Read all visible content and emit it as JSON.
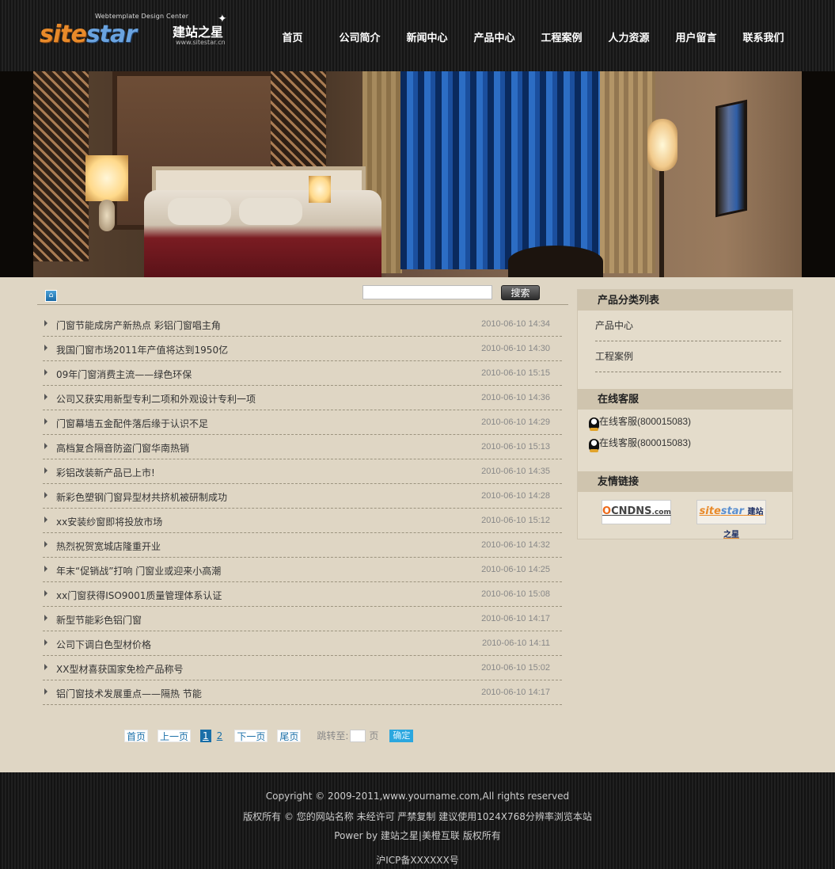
{
  "logo": {
    "sub": "Webtemplate Design Center",
    "brand_a": "site",
    "brand_b": "star",
    "brand_cn": "建站之星",
    "url": "www.sitestar.cn"
  },
  "nav": [
    "首页",
    "公司简介",
    "新闻中心",
    "产品中心",
    "工程案例",
    "人力资源",
    "用户留言",
    "联系我们"
  ],
  "search": {
    "placeholder": "",
    "button": "搜索"
  },
  "news": [
    {
      "title": "门窗节能成房产新热点 彩铝门窗唱主角",
      "date": "2010-06-10 14:34"
    },
    {
      "title": "我国门窗市场2011年产值将达到1950亿",
      "date": "2010-06-10 14:30"
    },
    {
      "title": "09年门窗消费主流——绿色环保",
      "date": "2010-06-10 15:15"
    },
    {
      "title": "公司又获实用新型专利二项和外观设计专利一项",
      "date": "2010-06-10 14:36"
    },
    {
      "title": "门窗幕墙五金配件落后缘于认识不足",
      "date": "2010-06-10 14:29"
    },
    {
      "title": "高档复合隔音防盗门窗华南热销",
      "date": "2010-06-10 15:13"
    },
    {
      "title": "彩铝改装新产品已上市!",
      "date": "2010-06-10 14:35"
    },
    {
      "title": "新彩色塑钢门窗异型材共挤机被研制成功",
      "date": "2010-06-10 14:28"
    },
    {
      "title": "xx安装纱窗即将投放市场",
      "date": "2010-06-10 15:12"
    },
    {
      "title": "热烈祝贺宽城店隆重开业",
      "date": "2010-06-10 14:32"
    },
    {
      "title": "年末“促销战”打响 门窗业或迎来小高潮",
      "date": "2010-06-10 14:25"
    },
    {
      "title": "xx门窗获得ISO9001质量管理体系认证",
      "date": "2010-06-10 15:08"
    },
    {
      "title": "新型节能彩色铝门窗",
      "date": "2010-06-10 14:17"
    },
    {
      "title": "公司下调白色型材价格",
      "date": "2010-06-10 14:11"
    },
    {
      "title": "XX型材喜获国家免检产品称号",
      "date": "2010-06-10 15:02"
    },
    {
      "title": "铝门窗技术发展重点——隔热 节能",
      "date": "2010-06-10 14:17"
    }
  ],
  "pager": {
    "first": "首页",
    "prev": "上一页",
    "pages": [
      "1",
      "2"
    ],
    "current": "1",
    "next": "下一页",
    "last": "尾页",
    "jump_label": "跳转至:",
    "page_unit": "页",
    "go": "确定"
  },
  "sidebar": {
    "categories_title": "产品分类列表",
    "categories": [
      "产品中心",
      "工程案例"
    ],
    "service_title": "在线客服",
    "services": [
      "在线客服(800015083)",
      "在线客服(800015083)"
    ],
    "links_title": "友情链接",
    "link_logos": [
      "CNDNS",
      "sitestar 建站之星"
    ]
  },
  "footer": {
    "copyright": "Copyright © 2009-2011,www.yourname.com,All rights reserved",
    "rights": "版权所有 © 您的网站名称 未经许可 严禁复制 建议使用1024X768分辨率浏览本站",
    "power": "Power by 建站之星|美橙互联 版权所有",
    "icp": "沪ICP备XXXXXX号"
  }
}
